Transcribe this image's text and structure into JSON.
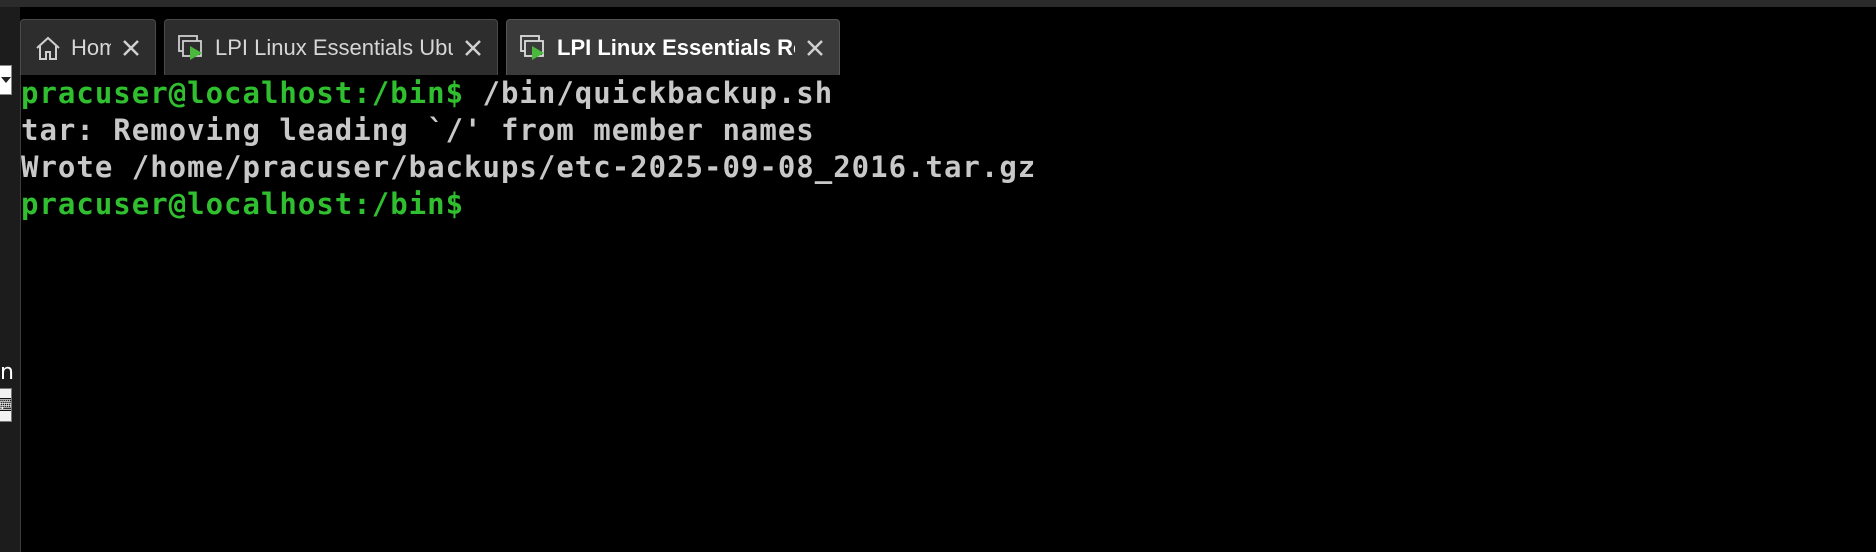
{
  "tabs": [
    {
      "label": "Home",
      "icon": "home-icon",
      "active": false
    },
    {
      "label": "LPI Linux Essentials Ubuntu Se...",
      "icon": "vm-console-icon",
      "active": false
    },
    {
      "label": "LPI Linux Essentials Rocky ...",
      "icon": "vm-console-icon",
      "active": true
    }
  ],
  "left_panel": {
    "glyph_text": "n"
  },
  "terminal": {
    "lines": [
      {
        "prompt": "pracuser@localhost:/bin$",
        "text": " /bin/quickbackup.sh"
      },
      {
        "prompt": "",
        "text": "tar: Removing leading `/' from member names"
      },
      {
        "prompt": "",
        "text": "Wrote /home/pracuser/backups/etc-2025-09-08_2016.tar.gz"
      },
      {
        "prompt": "pracuser@localhost:/bin$",
        "text": ""
      }
    ]
  },
  "colors": {
    "prompt": "#2fbf2f",
    "output": "#c8c8c8",
    "background": "#000000",
    "tab_active": "#3a3a3a",
    "tab_inactive": "#2d2d2d"
  }
}
